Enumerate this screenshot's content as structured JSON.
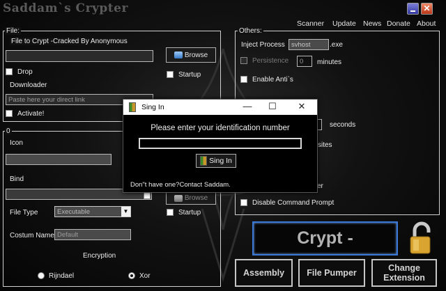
{
  "app": {
    "title": "Saddam`s Crypter"
  },
  "menu": {
    "items": [
      "Scanner",
      "Update",
      "News",
      "Donate",
      "About"
    ]
  },
  "file_group": {
    "label": "File:",
    "file_to_crypt_label": "File to Crypt -Cracked By Anonymous",
    "file_path_value": "",
    "browse_label": "Browse",
    "drop_label": "Drop",
    "drop_checked": false,
    "startup_label": "Startup",
    "startup_checked": false,
    "downloader_label": "Downloader",
    "direct_link_placeholder": "Paste here your direct link",
    "activate_label": "Activate!",
    "activate_checked": false
  },
  "bind_group": {
    "label": "0",
    "icon_label": "Icon",
    "icon_value": "",
    "bind_label": "Bind",
    "bind_value": "",
    "browse_label": "Browse",
    "startup_label": "Startup",
    "file_type_label": "File Type",
    "file_type_value": "Executable",
    "costum_name_label": "Costum Name",
    "costum_name_value": "Default",
    "encryption_label": "Encryption",
    "rijndael_label": "Rijndael",
    "xor_label": "Xor",
    "selected_encryption": "Xor"
  },
  "others_group": {
    "label": "Others:",
    "inject_process_label": "Inject Process",
    "inject_process_value": "svhost",
    "inject_ext": ".exe",
    "persistence_label": "Persistence",
    "persistence_value": "0",
    "minutes_label": "minutes",
    "enable_anti_label": "Enable Anti`s",
    "seconds_label": "seconds",
    "partial_sites_label": "sites",
    "partial_er_label": "er",
    "disable_cmd_label": "Disable Command Prompt"
  },
  "actions": {
    "crypt_label": "Crypt -",
    "assembly_label": "Assembly",
    "file_pumper_label": "File Pumper",
    "change_extension_label": "Change Extension"
  },
  "dialog": {
    "title": "Sing In",
    "prompt": "Please enter your identification number",
    "input_value": "",
    "signin_button_label": "Sing In",
    "footer": "Don\"t have one?Contact Saddam.",
    "controls": {
      "minimize": "—",
      "maximize": "☐",
      "close": "✕"
    }
  },
  "colors": {
    "accent_blue": "#3a78d8",
    "background": "#070707"
  }
}
